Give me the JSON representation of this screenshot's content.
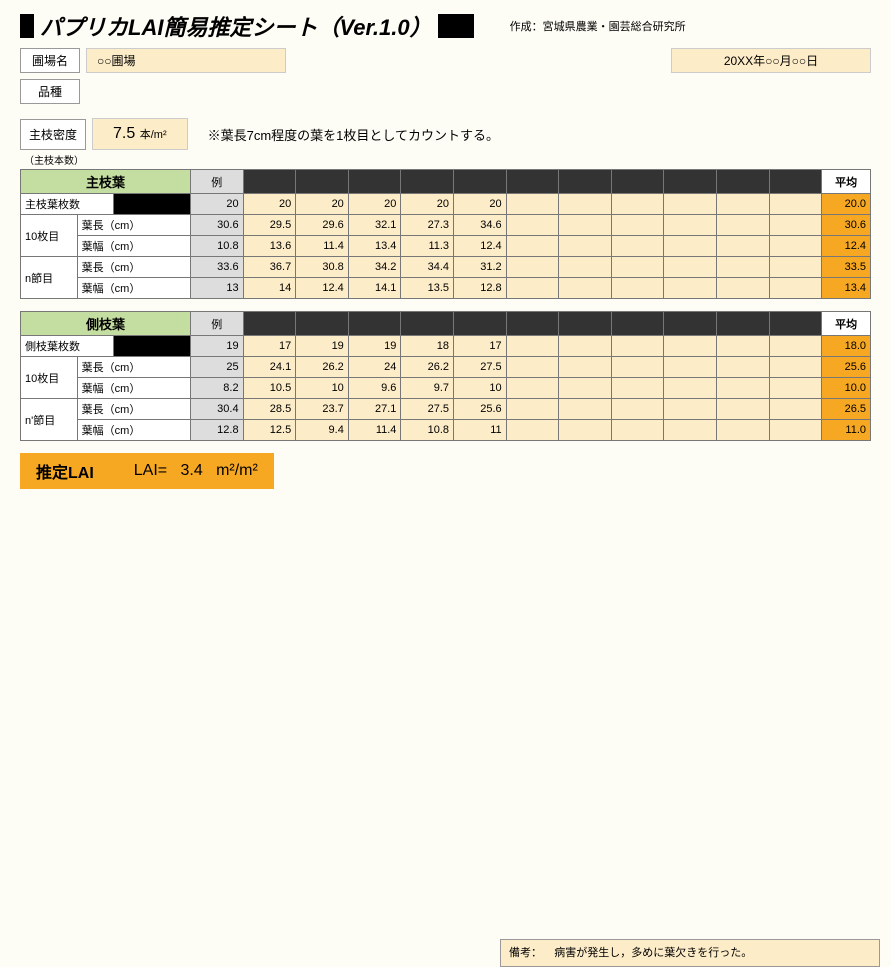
{
  "title_prefix_block_w": 14,
  "title": "パプリカLAI簡易推定シート（Ver.1.0）",
  "title_suffix_block_w": 36,
  "credit": "作成：宮城県農業・園芸総合研究所",
  "field_label": "圃場名",
  "field_value": "○○圃場",
  "date_value": "20XX年○○月○○日",
  "variety_label": "品種",
  "density_label": "主枝密度",
  "density_value": "7.5",
  "density_unit": "本/m²",
  "count_note": "※葉長7cm程度の葉を1枚目としてカウントする。",
  "density_sub": "（主枝本数）",
  "sections": [
    {
      "name": "主枝葉",
      "count_label": "主枝葉枚数",
      "count_eg": "20",
      "count_vals": [
        "20",
        "20",
        "20",
        "20",
        "20",
        "",
        "",
        "",
        "",
        "",
        ""
      ],
      "count_avg": "20.0",
      "groups": [
        {
          "g": "10枚目",
          "rows": [
            {
              "l": "葉長（cm）",
              "eg": "30.6",
              "v": [
                "29.5",
                "29.6",
                "32.1",
                "27.3",
                "34.6",
                "",
                "",
                "",
                "",
                "",
                ""
              ],
              "avg": "30.6"
            },
            {
              "l": "葉幅（cm）",
              "eg": "10.8",
              "v": [
                "13.6",
                "11.4",
                "13.4",
                "11.3",
                "12.4",
                "",
                "",
                "",
                "",
                "",
                ""
              ],
              "avg": "12.4"
            }
          ]
        },
        {
          "g": "n節目",
          "rows": [
            {
              "l": "葉長（cm）",
              "eg": "33.6",
              "v": [
                "36.7",
                "30.8",
                "34.2",
                "34.4",
                "31.2",
                "",
                "",
                "",
                "",
                "",
                ""
              ],
              "avg": "33.5"
            },
            {
              "l": "葉幅（cm）",
              "eg": "13",
              "v": [
                "14",
                "12.4",
                "14.1",
                "13.5",
                "12.8",
                "",
                "",
                "",
                "",
                "",
                ""
              ],
              "avg": "13.4"
            }
          ]
        }
      ]
    },
    {
      "name": "側枝葉",
      "count_label": "側枝葉枚数",
      "count_eg": "19",
      "count_vals": [
        "17",
        "19",
        "19",
        "18",
        "17",
        "",
        "",
        "",
        "",
        "",
        ""
      ],
      "count_avg": "18.0",
      "groups": [
        {
          "g": "10枚目",
          "rows": [
            {
              "l": "葉長（cm）",
              "eg": "25",
              "v": [
                "24.1",
                "26.2",
                "24",
                "26.2",
                "27.5",
                "",
                "",
                "",
                "",
                "",
                ""
              ],
              "avg": "25.6"
            },
            {
              "l": "葉幅（cm）",
              "eg": "8.2",
              "v": [
                "10.5",
                "10",
                "9.6",
                "9.7",
                "10",
                "",
                "",
                "",
                "",
                "",
                ""
              ],
              "avg": "10.0"
            }
          ]
        },
        {
          "g": "n'節目",
          "rows": [
            {
              "l": "葉長（cm）",
              "eg": "30.4",
              "v": [
                "28.5",
                "23.7",
                "27.1",
                "27.5",
                "25.6",
                "",
                "",
                "",
                "",
                "",
                ""
              ],
              "avg": "26.5"
            },
            {
              "l": "葉幅（cm）",
              "eg": "12.8",
              "v": [
                "12.5",
                "9.4",
                "11.4",
                "10.8",
                "11",
                "",
                "",
                "",
                "",
                "",
                ""
              ],
              "avg": "11.0"
            }
          ]
        }
      ]
    }
  ],
  "eg_header": "例",
  "avg_header": "平均",
  "lai_label": "推定LAI",
  "lai_eq": "LAI=",
  "lai_value": "3.4",
  "lai_unit": "m²/m²",
  "remark_label": "備考：",
  "remark_text": "病害が発生し，多めに葉欠きを行った。"
}
